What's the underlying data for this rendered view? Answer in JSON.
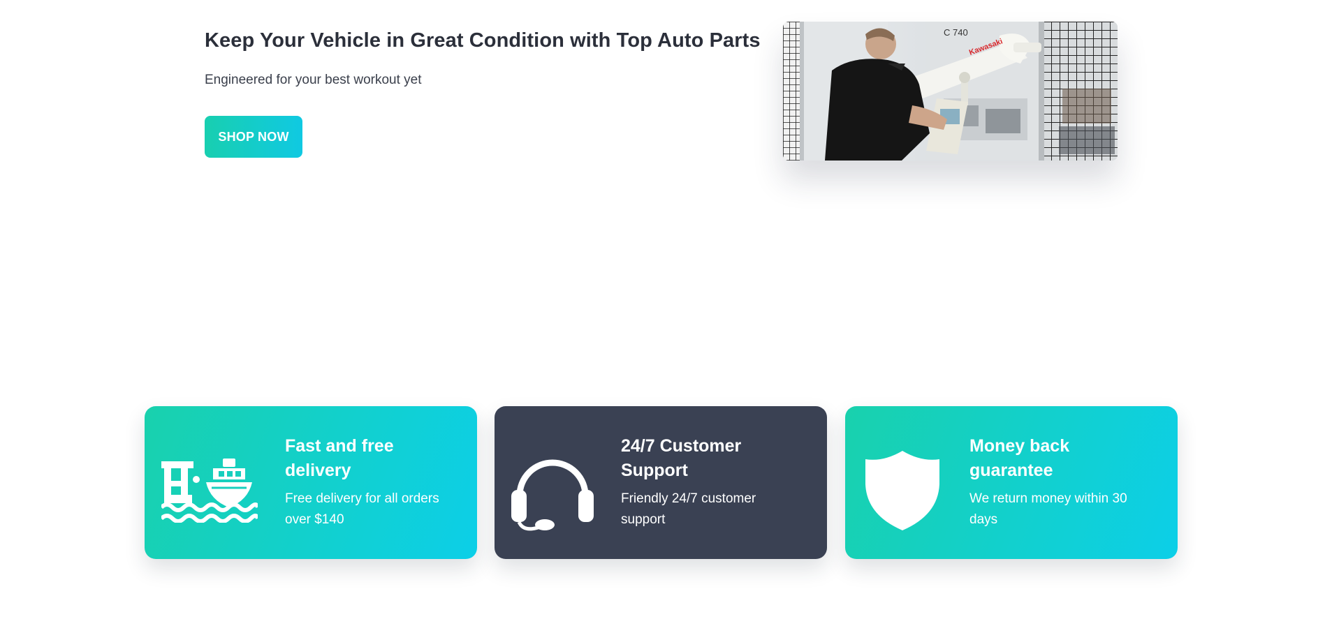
{
  "hero": {
    "title": "Keep Your Vehicle in Great Condition with Top Auto Parts",
    "subtitle": "Engineered for your best workout yet",
    "cta_label": "SHOP NOW",
    "image_label_model": "C 740",
    "image_label_brand": "Kawasaki"
  },
  "features": [
    {
      "icon": "ship-delivery-icon",
      "title": "Fast and free delivery",
      "description": "Free delivery for all orders over $140",
      "style": "teal"
    },
    {
      "icon": "headset-icon",
      "title": "24/7 Customer Support",
      "description": "Friendly 24/7 customer support",
      "style": "dark"
    },
    {
      "icon": "shield-icon",
      "title": "Money back guarantee",
      "description": "We return money within 30 days",
      "style": "teal"
    }
  ],
  "colors": {
    "accent_start": "#18cfb0",
    "accent_end": "#10c9e2",
    "dark_card": "#3a4153",
    "text": "#2b2f3a"
  }
}
